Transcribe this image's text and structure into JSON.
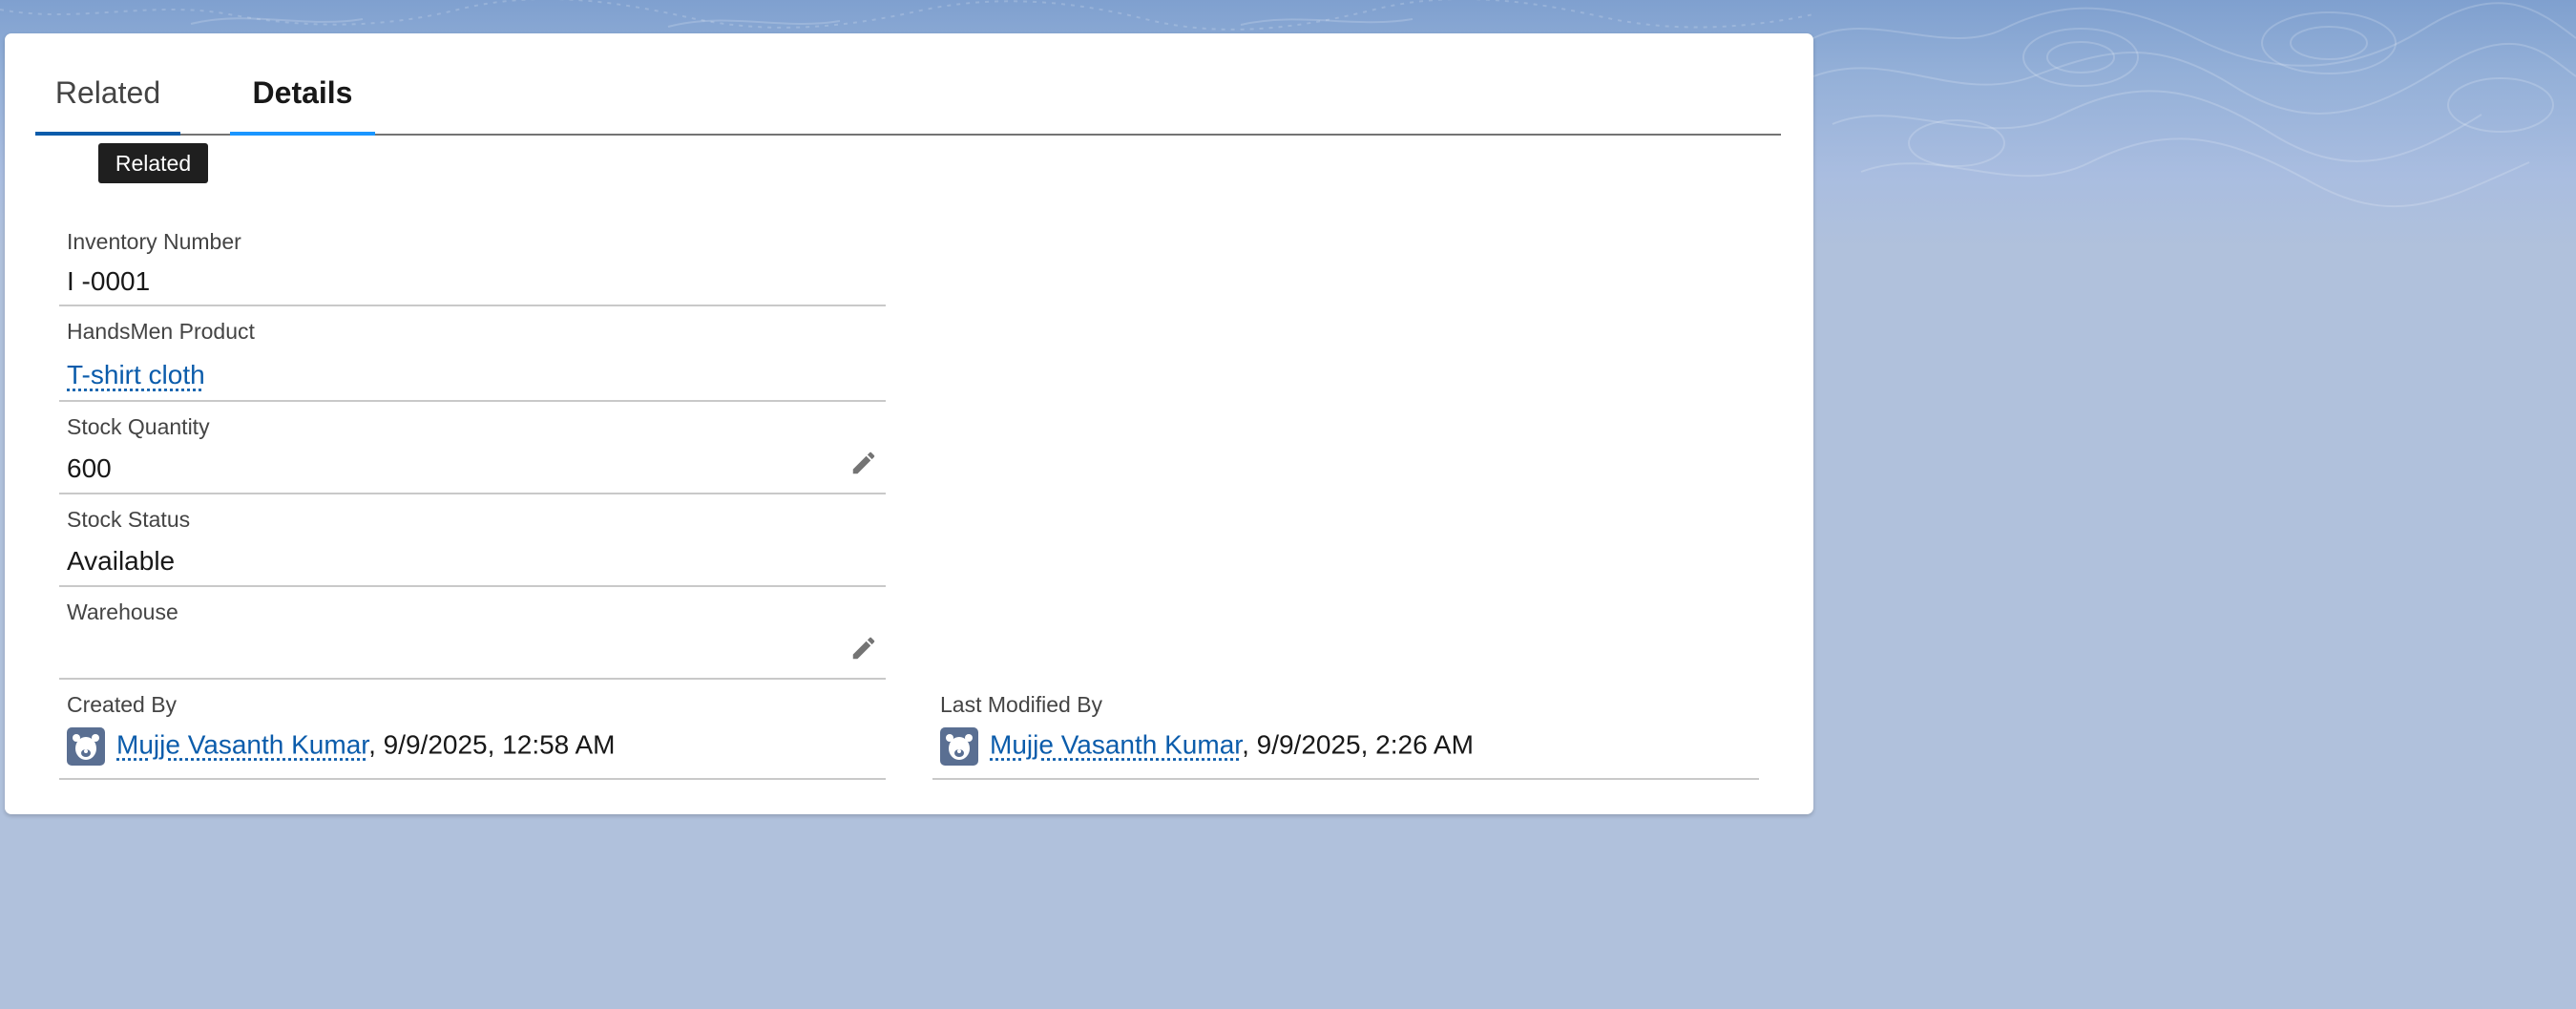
{
  "tabs": [
    {
      "label": "Related",
      "active": false
    },
    {
      "label": "Details",
      "active": true
    }
  ],
  "tooltip": {
    "text": "Related"
  },
  "fields": {
    "inventory_number": {
      "label": "Inventory Number",
      "value": "I -0001"
    },
    "handsmen_product": {
      "label": "HandsMen Product",
      "value": "T-shirt cloth"
    },
    "stock_quantity": {
      "label": "Stock Quantity",
      "value": "600"
    },
    "stock_status": {
      "label": "Stock Status",
      "value": "Available"
    },
    "warehouse": {
      "label": "Warehouse",
      "value": ""
    },
    "created_by": {
      "label": "Created By",
      "user": "Mujje Vasanth Kumar",
      "timestamp": ", 9/9/2025, 12:58 AM"
    },
    "last_modified_by": {
      "label": "Last Modified By",
      "user": "Mujje Vasanth Kumar",
      "timestamp": ", 9/9/2025, 2:26 AM"
    }
  },
  "icons": {
    "edit": "pencil-icon",
    "avatar": "user-avatar-icon"
  },
  "colors": {
    "link": "#0b5cab",
    "active_tab_underline": "#1b96ff",
    "page_background": "#b0c1dc",
    "tooltip_background": "#1f1f1f"
  }
}
